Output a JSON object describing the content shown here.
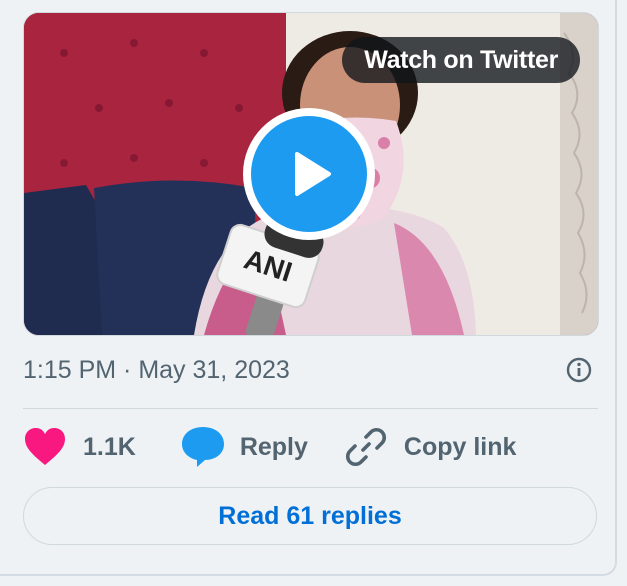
{
  "media": {
    "watch_label": "Watch on Twitter",
    "play_icon": "play-icon",
    "mic_logo_text": "ANI"
  },
  "meta": {
    "timestamp": "1:15 PM · May 31, 2023",
    "info_icon": "info-icon"
  },
  "actions": {
    "like_icon": "heart-icon",
    "like_count": "1.1K",
    "reply_icon": "speech-bubble-icon",
    "reply_label": "Reply",
    "copy_icon": "link-icon",
    "copy_label": "Copy link"
  },
  "footer": {
    "read_replies_label": "Read 61 replies"
  },
  "colors": {
    "accent_blue": "#1d9bf0",
    "link_blue": "#006fd6",
    "heart_pink": "#f91880",
    "muted_text": "#536471",
    "background": "#eef2f5"
  }
}
